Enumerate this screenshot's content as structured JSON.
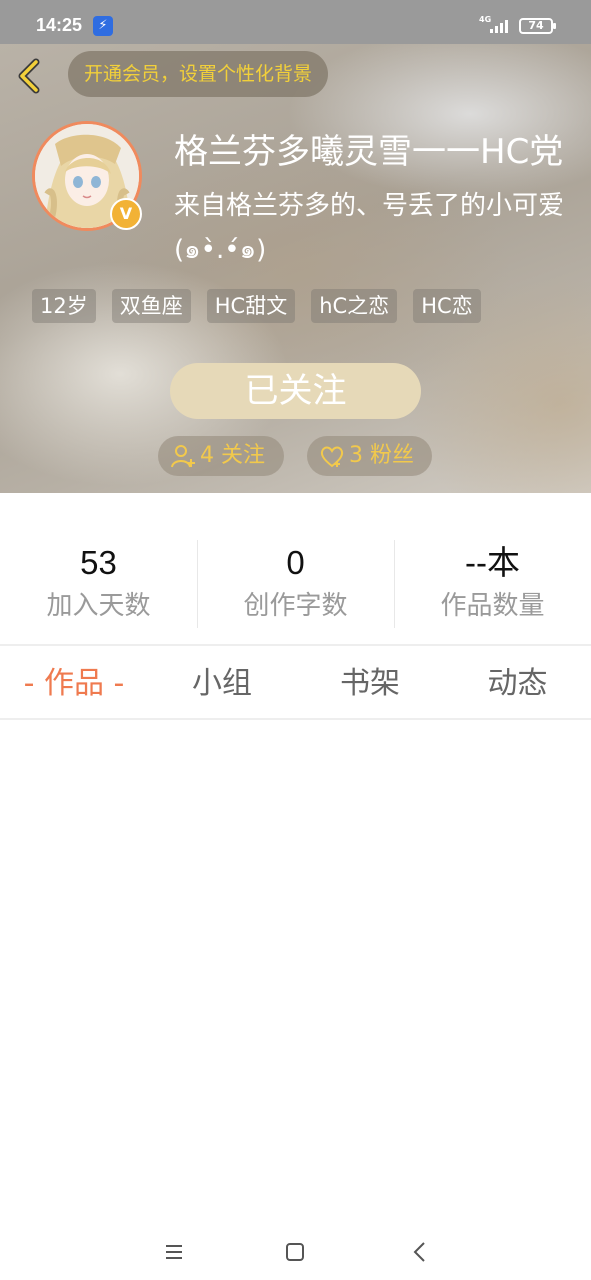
{
  "status_bar": {
    "time": "14:25",
    "network": "4G",
    "battery": "74",
    "app_icon": "bolt-icon"
  },
  "header": {
    "back_icon": "chevron-left-icon",
    "vip_banner": "开通会员，设置个性化背景",
    "nickname": "格兰芬多曦灵雪一一HC党",
    "bio": "来自格兰芬多的、号丢了的小可爱(๑•̀.•́๑)",
    "vip_badge": "V",
    "tags": [
      "12岁",
      "双鱼座",
      "HC甜文",
      "hC之恋",
      "HC恋"
    ],
    "follow_button": "已关注",
    "following": "4 关注",
    "fans": "3 粉丝",
    "accent_color": "#f2c94c"
  },
  "stats": [
    {
      "value": "53",
      "label": "加入天数"
    },
    {
      "value": "0",
      "label": "创作字数"
    },
    {
      "value": "--本",
      "label": "作品数量"
    }
  ],
  "tabs": [
    {
      "label": "- 作品 -",
      "active": true
    },
    {
      "label": "小组",
      "active": false
    },
    {
      "label": "书架",
      "active": false
    },
    {
      "label": "动态",
      "active": false
    }
  ],
  "colors": {
    "active_tab": "#ef7a4f",
    "avatar_border": "#f08a5d"
  },
  "nav_bar": {
    "menu_icon": "menu-icon",
    "home_icon": "square-home-icon",
    "back_icon": "triangle-back-icon"
  }
}
